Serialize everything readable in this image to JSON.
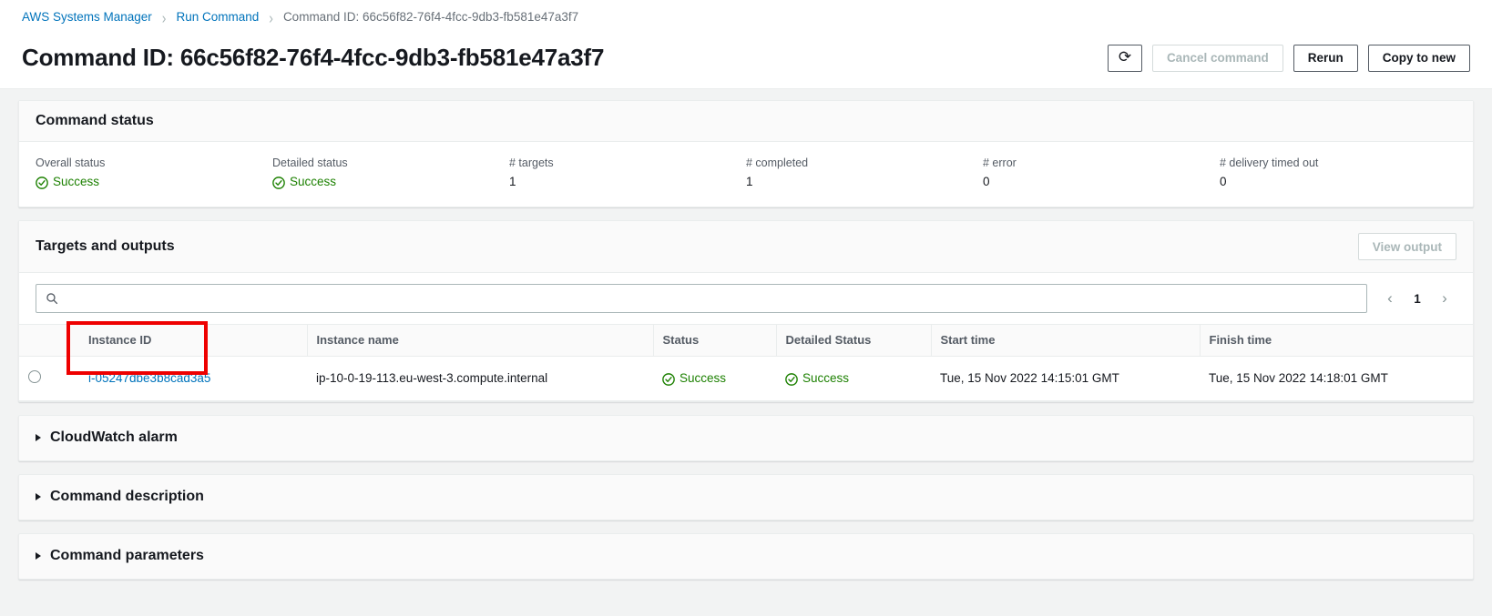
{
  "breadcrumb": {
    "items": [
      {
        "label": "AWS Systems Manager",
        "type": "link"
      },
      {
        "label": "Run Command",
        "type": "link"
      },
      {
        "label": "Command ID: 66c56f82-76f4-4fcc-9db3-fb581e47a3f7",
        "type": "current"
      }
    ],
    "separator": "›"
  },
  "header": {
    "title": "Command ID: 66c56f82-76f4-4fcc-9db3-fb581e47a3f7",
    "refresh_icon": "refresh-icon",
    "refresh_glyph": "⟳",
    "cancel_label": "Cancel command",
    "rerun_label": "Rerun",
    "copy_label": "Copy to new"
  },
  "command_status": {
    "title": "Command status",
    "fields": [
      {
        "label": "Overall status",
        "value": "Success",
        "status": true
      },
      {
        "label": "Detailed status",
        "value": "Success",
        "status": true
      },
      {
        "label": "# targets",
        "value": "1",
        "status": false
      },
      {
        "label": "# completed",
        "value": "1",
        "status": false
      },
      {
        "label": "# error",
        "value": "0",
        "status": false
      },
      {
        "label": "# delivery timed out",
        "value": "0",
        "status": false
      }
    ]
  },
  "targets": {
    "title": "Targets and outputs",
    "view_output_label": "View output",
    "search": {
      "value": "",
      "placeholder": "",
      "icon": "search-icon"
    },
    "pagination": {
      "prev": "‹",
      "page": "1",
      "next": "›"
    },
    "columns": [
      "Instance ID",
      "Instance name",
      "Status",
      "Detailed Status",
      "Start time",
      "Finish time"
    ],
    "rows": [
      {
        "instance_id": "i-05247dbe3b8cad3a5",
        "instance_name": "ip-10-0-19-113.eu-west-3.compute.internal",
        "status": "Success",
        "detailed_status": "Success",
        "start_time": "Tue, 15 Nov 2022 14:15:01 GMT",
        "finish_time": "Tue, 15 Nov 2022 14:18:01 GMT"
      }
    ]
  },
  "sections": [
    {
      "label": "CloudWatch alarm"
    },
    {
      "label": "Command description"
    },
    {
      "label": "Command parameters"
    }
  ],
  "colors": {
    "link": "#0073bb",
    "success": "#1d8102",
    "annotation": "#ee0000",
    "muted": "#687078"
  }
}
